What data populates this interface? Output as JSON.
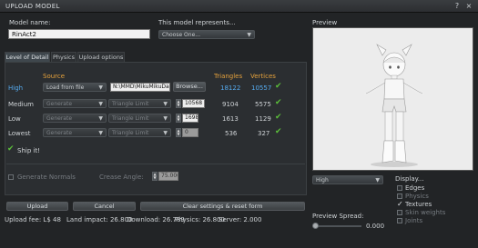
{
  "window": {
    "title": "UPLOAD MODEL",
    "help_label": "?",
    "close_label": "×"
  },
  "model_name": {
    "label": "Model name:",
    "value": "RinAct2"
  },
  "represents": {
    "label": "This model represents...",
    "selected": "Choose One..."
  },
  "tabs": [
    {
      "label": "Level of Detail",
      "active": true
    },
    {
      "label": "Physics",
      "active": false
    },
    {
      "label": "Upload options",
      "active": false
    }
  ],
  "lod_table": {
    "headers": {
      "source": "Source",
      "triangles": "Triangles",
      "vertices": "Vertices"
    },
    "rows": [
      {
        "label": "High",
        "source": "Load from file",
        "file_path": "N:\\MMD\\MikuMikuDan",
        "browse_label": "Browse...",
        "triangles": "18122",
        "vertices": "10557",
        "ok": true
      },
      {
        "label": "Medium",
        "source": "Generate",
        "method": "Triangle Limit",
        "limit": "10568",
        "triangles": "9104",
        "vertices": "5575",
        "ok": true
      },
      {
        "label": "Low",
        "source": "Generate",
        "method": "Triangle Limit",
        "limit": "1698",
        "triangles": "1613",
        "vertices": "1129",
        "ok": true
      },
      {
        "label": "Lowest",
        "source": "Generate",
        "method": "Triangle Limit",
        "limit": "0",
        "triangles": "536",
        "vertices": "327",
        "ok": true
      }
    ],
    "ship_it": "Ship it!"
  },
  "normals": {
    "generate_label": "Generate Normals",
    "crease_label": "Crease Angle:",
    "crease_value": "75.000"
  },
  "buttons": {
    "upload": "Upload",
    "cancel": "Cancel",
    "clear": "Clear settings & reset form"
  },
  "status": {
    "upload_fee": "Upload fee: L$ 48",
    "land_impact": "Land impact: 26.800",
    "download": "Download: 26.789",
    "physics": "Physics: 26.800",
    "server": "Server: 2.000"
  },
  "preview": {
    "label": "Preview",
    "lod_selected": "High",
    "display_label": "Display...",
    "options": [
      {
        "label": "Edges",
        "checked": false,
        "enabled": true
      },
      {
        "label": "Physics",
        "checked": false,
        "enabled": false
      },
      {
        "label": "Textures",
        "checked": true,
        "enabled": true
      },
      {
        "label": "Skin weights",
        "checked": false,
        "enabled": false
      },
      {
        "label": "Joints",
        "checked": false,
        "enabled": false
      }
    ],
    "spread_label": "Preview Spread:",
    "spread_value": "0.000"
  },
  "colors": {
    "accent_orange": "#e6a23c",
    "accent_blue": "#55aaee",
    "ok_green": "#5bbf3a"
  }
}
